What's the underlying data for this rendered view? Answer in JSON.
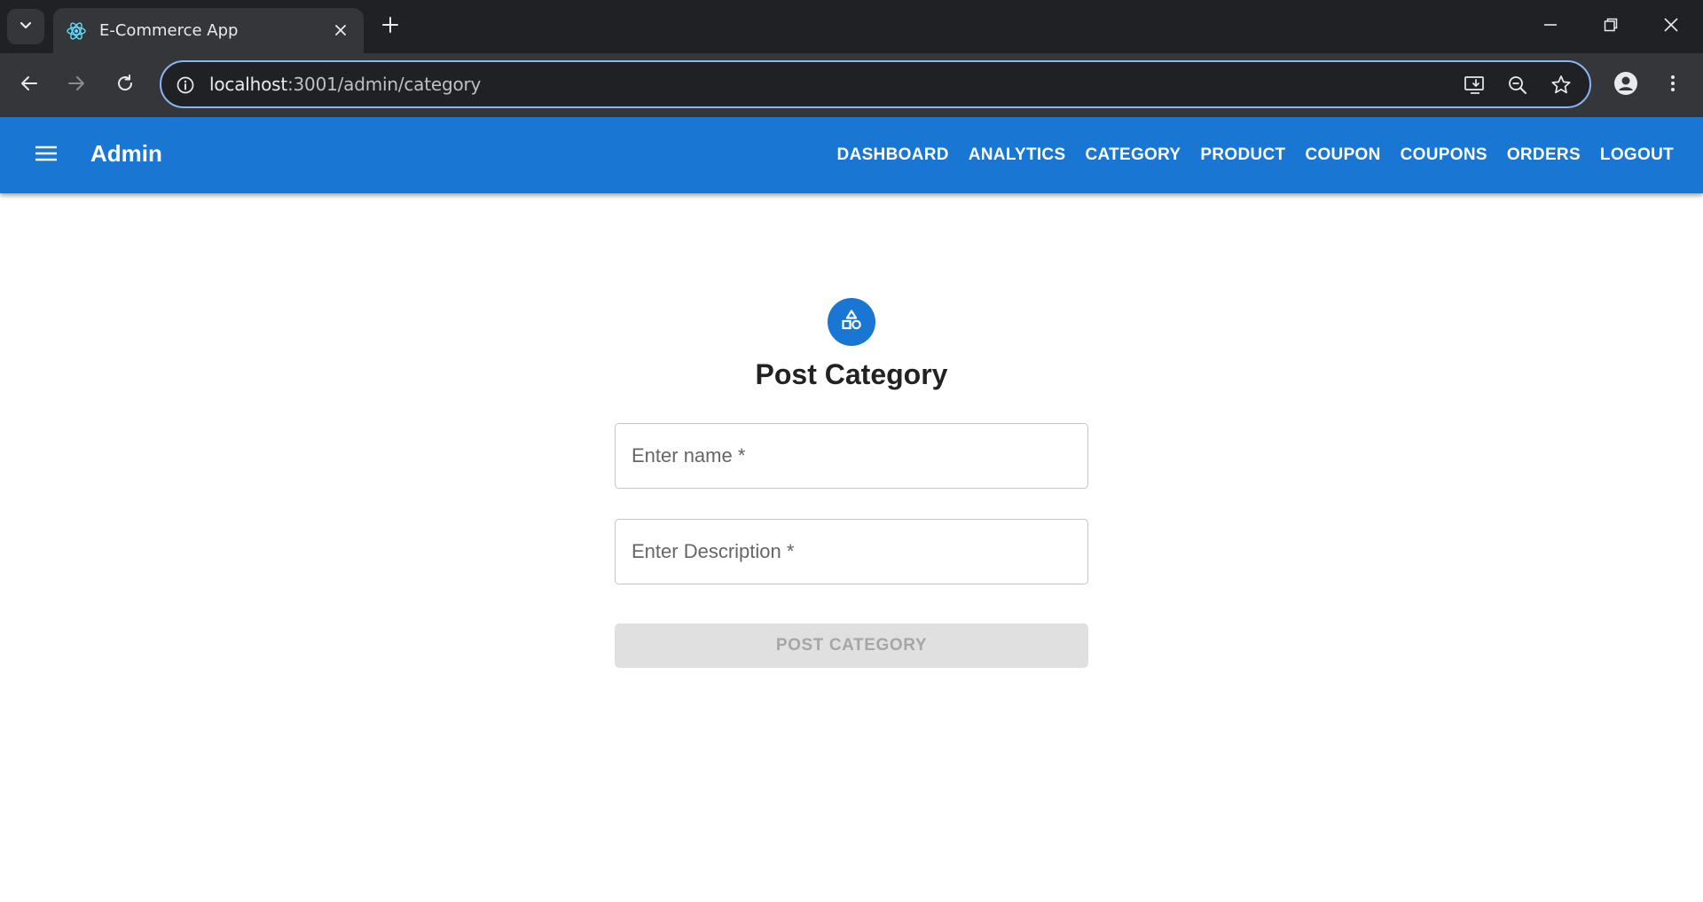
{
  "browser": {
    "tab_title": "E-Commerce App",
    "tab_favicon": "react-icon",
    "url_host": "localhost",
    "url_path": ":3001/admin/category"
  },
  "appbar": {
    "brand": "Admin",
    "color": "#1976d2",
    "links": [
      "DASHBOARD",
      "ANALYTICS",
      "CATEGORY",
      "PRODUCT",
      "COUPON",
      "COUPONS",
      "ORDERS",
      "LOGOUT"
    ]
  },
  "form": {
    "icon": "category-icon",
    "title": "Post Category",
    "name_placeholder": "Enter name *",
    "description_placeholder": "Enter Description *",
    "submit_label": "POST CATEGORY",
    "submit_disabled": true
  }
}
